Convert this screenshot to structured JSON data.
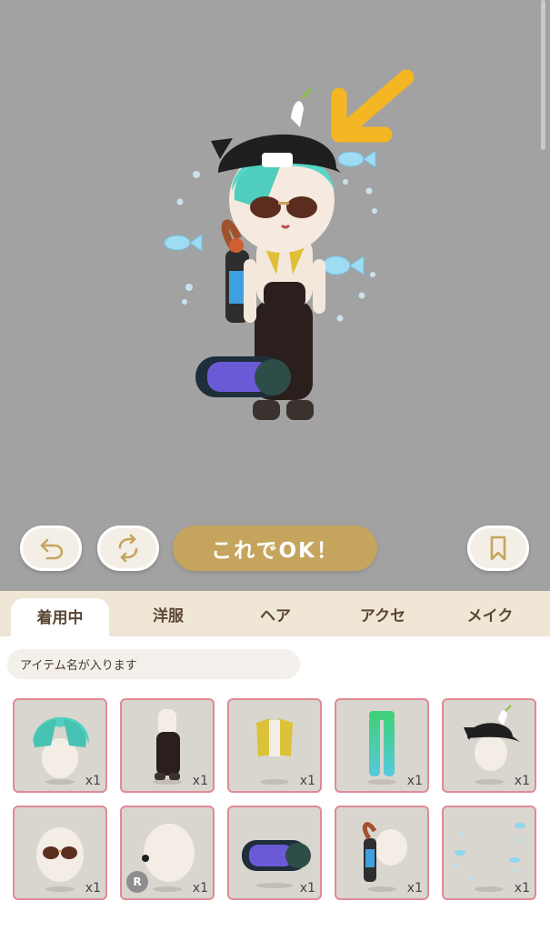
{
  "toolbar": {
    "undo_icon": "undo-arrow-icon",
    "randomize_icon": "refresh-arrows-icon",
    "ok_label": "これでOK！",
    "bookmark_icon": "bookmark-icon"
  },
  "tabs": [
    {
      "label": "着用中",
      "active": true
    },
    {
      "label": "洋服",
      "active": false
    },
    {
      "label": "ヘア",
      "active": false
    },
    {
      "label": "アクセ",
      "active": false
    },
    {
      "label": "メイク",
      "active": false
    }
  ],
  "item_name_placeholder": "アイテム名が入ります",
  "items": [
    {
      "name": "teal-hair-thumbnail",
      "qty": "x1"
    },
    {
      "name": "black-overalls-thumbnail",
      "qty": "x1"
    },
    {
      "name": "yellow-vest-thumbnail",
      "qty": "x1"
    },
    {
      "name": "green-leggings-thumbnail",
      "qty": "x1"
    },
    {
      "name": "black-cap-thumbnail",
      "qty": "x1"
    },
    {
      "name": "sunglasses-thumbnail",
      "qty": "x1"
    },
    {
      "name": "earring-thumbnail",
      "qty": "x1",
      "badge": "R"
    },
    {
      "name": "aquarium-bag-thumbnail",
      "qty": "x1"
    },
    {
      "name": "air-tank-thumbnail",
      "qty": "x1"
    },
    {
      "name": "bubbles-fish-effect-thumbnail",
      "qty": "x1"
    }
  ],
  "colors": {
    "stage_bg": "#a2a2a2",
    "ok_button": "#c5a55d",
    "tab_bar": "#f0e6d6",
    "cell_border": "#e08a96",
    "icon_gold": "#c5a55d",
    "arrow_annotation": "#f4b623"
  }
}
